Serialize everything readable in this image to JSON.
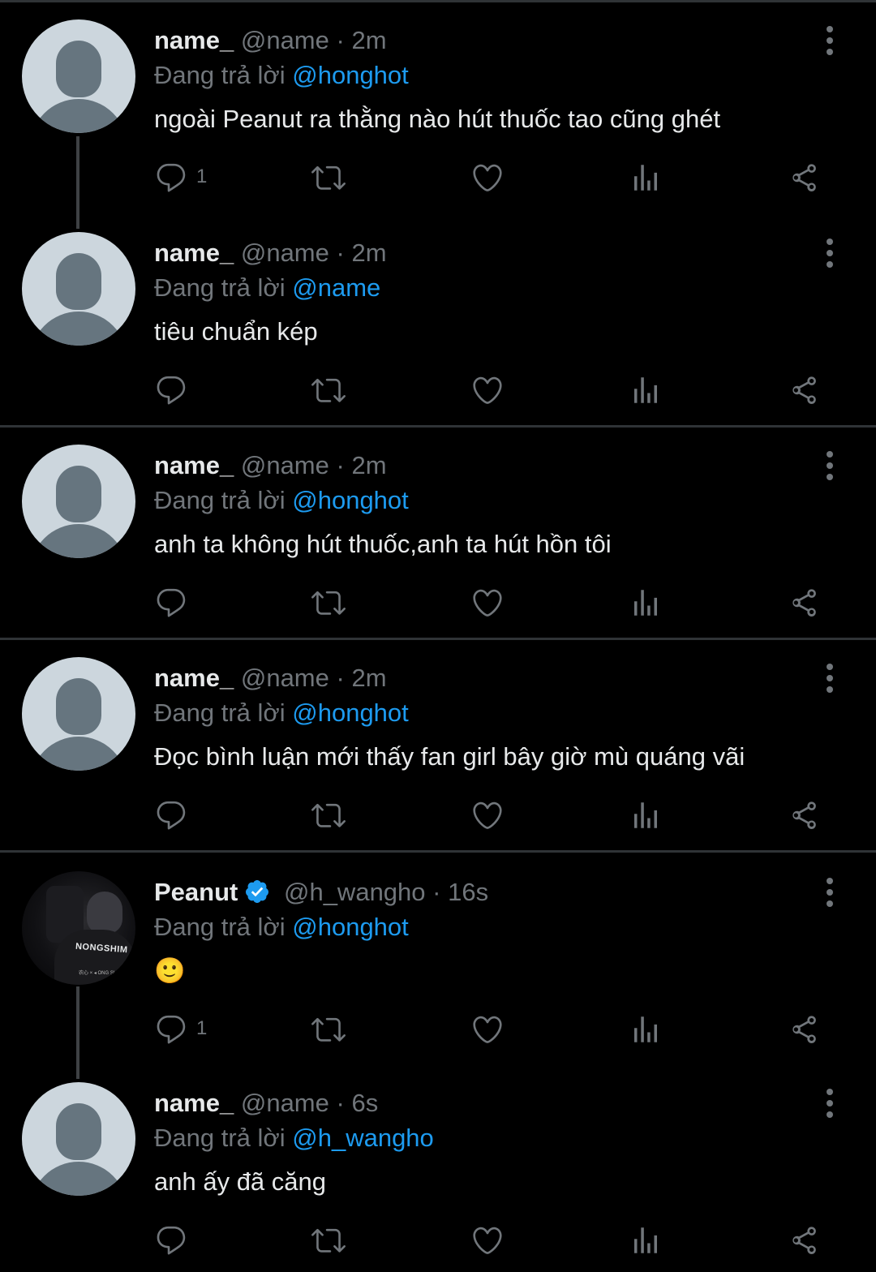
{
  "reply_prefix": "Đang trả lời",
  "dot": "·",
  "tweets": [
    {
      "name": "name_",
      "handle": "@name",
      "time": "2m",
      "reply_to": "@honghot",
      "text": "ngoài Peanut ra thằng nào hút thuốc tao cũng ghét",
      "reply_count": "1"
    },
    {
      "name": "name_",
      "handle": "@name",
      "time": "2m",
      "reply_to": "@name",
      "text": "tiêu chuẩn kép",
      "reply_count": ""
    },
    {
      "name": "name_",
      "handle": "@name",
      "time": "2m",
      "reply_to": "@honghot",
      "text": "anh ta không hút thuốc,anh ta hút hồn tôi",
      "reply_count": ""
    },
    {
      "name": "name_",
      "handle": "@name",
      "time": "2m",
      "reply_to": "@honghot",
      "text": "Đọc bình luận mới thấy fan girl bây giờ mù quáng vãi",
      "reply_count": ""
    },
    {
      "name": "Peanut",
      "handle": "@h_wangho",
      "time": "16s",
      "reply_to": "@honghot",
      "text": "🙂",
      "reply_count": "1",
      "verified": true,
      "avatar_text": "NONGSHIM",
      "avatar_small_text": "农心 × ◂ ONG SHIM"
    },
    {
      "name": "name_",
      "handle": "@name",
      "time": "6s",
      "reply_to": "@h_wangho",
      "text": "anh ấy đã căng",
      "reply_count": ""
    }
  ],
  "icons": [
    "reply-icon",
    "retweet-icon",
    "like-icon",
    "views-icon",
    "share-icon",
    "more-icon",
    "verified-icon",
    "default-avatar-icon"
  ],
  "colors": {
    "background": "#000000",
    "text": "#e7e9ea",
    "muted": "#71767b",
    "accent": "#1d9bf0",
    "divider": "#2f3336"
  }
}
